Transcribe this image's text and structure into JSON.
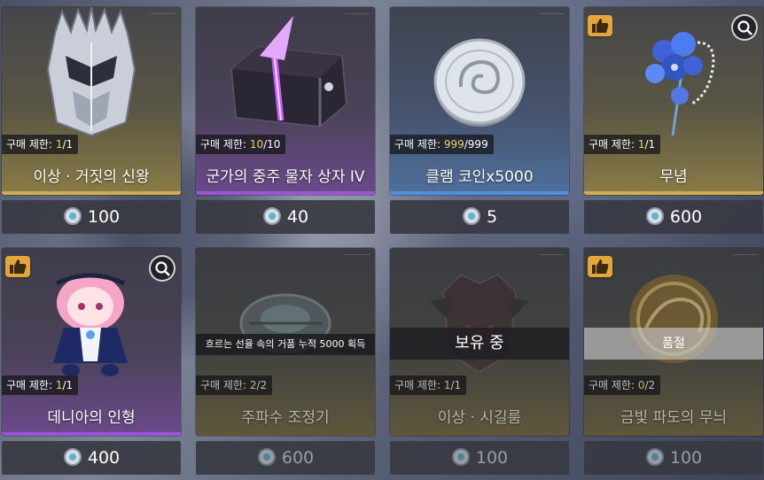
{
  "items": [
    {
      "name": "이상 · 거짓의 신왕",
      "limit_label": "구매 제한: ",
      "limit_current": "1",
      "limit_max": "/1",
      "price": "100",
      "icon": "silver-crowned-helm-icon"
    },
    {
      "name": "군가의 중주 물자 상자 IV",
      "limit_label": "구매 제한: ",
      "limit_current": "10",
      "limit_max": "/10",
      "price": "40",
      "icon": "purple-supply-chest-icon"
    },
    {
      "name": "클램 코인x5000",
      "limit_label": "구매 제한: ",
      "limit_current": "999",
      "limit_max": "/999",
      "price": "5",
      "icon": "silver-shell-coin-icon"
    },
    {
      "name": "무념",
      "limit_label": "구매 제한: ",
      "limit_current": "1",
      "limit_max": "/1",
      "price": "600",
      "icon": "blue-flower-bouquet-icon"
    },
    {
      "name": "데니아의 인형",
      "limit_label": "구매 제한: ",
      "limit_current": "1",
      "limit_max": "/1",
      "price": "400",
      "icon": "pink-haired-doll-icon"
    },
    {
      "name": "주파수 조정기",
      "limit_label": "구매 제한: ",
      "limit_current": "2",
      "limit_max": "/2",
      "price": "600",
      "icon": "frequency-tuner-icon",
      "hint": "흐르는 선율 속의 거품 누적 5000 획득"
    },
    {
      "name": "이상 · 시길룸",
      "limit_label": "구매 제한: ",
      "limit_current": "1",
      "limit_max": "/1",
      "price": "100",
      "icon": "dark-armored-mask-icon",
      "overlay": "보유 중"
    },
    {
      "name": "금빛 파도의 무늬",
      "limit_label": "구매 제한: ",
      "limit_current": "0",
      "limit_max": "/2",
      "price": "100",
      "icon": "golden-wave-orb-icon",
      "overlay": "품절"
    }
  ],
  "currency_icon": "shell-credit-coin-icon",
  "colors": {
    "rarity_gold": "#cfae4d",
    "rarity_purple": "#9b54d6",
    "rarity_blue": "#4d8fe0",
    "badge": "#e2a63a",
    "limit_highlight": "#f2d36b"
  }
}
